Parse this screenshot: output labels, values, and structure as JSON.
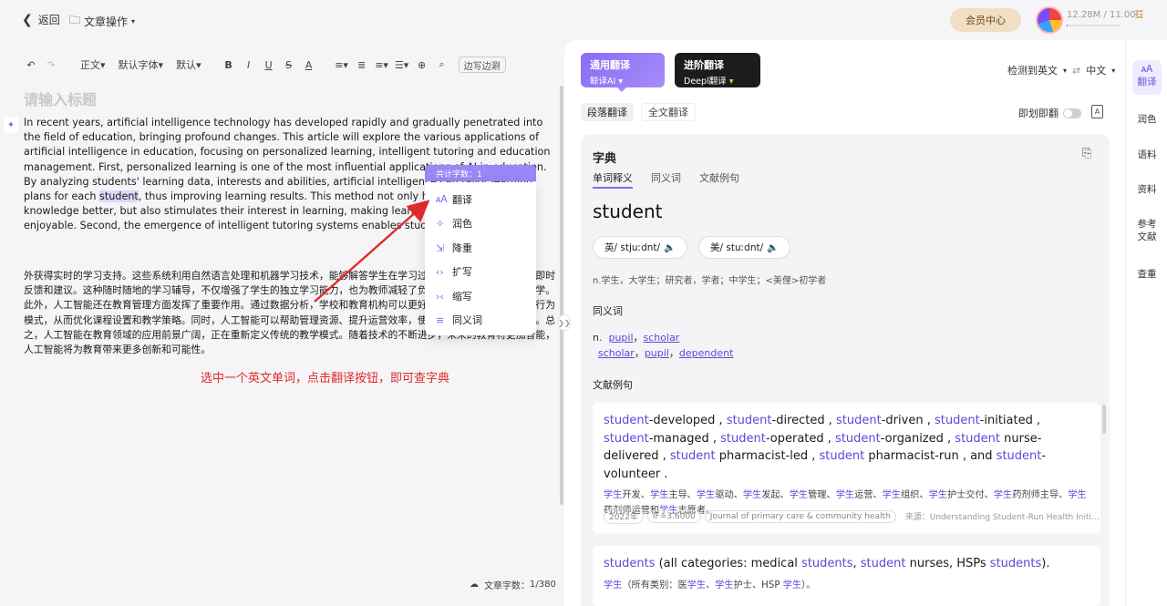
{
  "header": {
    "back_label": "返回",
    "doc_menu_label": "文章操作",
    "member_label": "会员中心",
    "storage_text": "12.28M / 11.00G",
    "storage_used_fraction": 0.01
  },
  "toolbar": {
    "style_label": "正文",
    "font_label": "默认字体",
    "size_label": "默认",
    "edit_border_label": "边写边涮"
  },
  "editor": {
    "title_placeholder": "请输入标题",
    "en_before": "In recent years, artificial intelligence technology has developed rapidly and gradually penetrated into the field of education, bringing profound changes. This article will explore the various applications of artificial intelligence in education, focusing on personalized learning, intelligent tutoring and education management. First, personalized learning is one of the most influential applications of AI in education. By analyzing students' learning data, interests and abilities, artificial intelligence can tailor learning plans for each ",
    "en_highlight": "student",
    "en_after": ", thus improving learning results. This method not only helps students master knowledge better, but also stimulates their interest in learning, making learning more efficient and enjoyable. Second, the emergence of intelligent tutoring systems enables students to learn in class.",
    "zh_para": "外获得实时的学习支持。这些系统利用自然语言处理和机器学习技术，能够解答学生在学习过程中遇到的问题，并提供即时反馈和建议。这种随时随地的学习辅导，不仅增强了学生的独立学习能力，也为教师减轻了负担，让他们有更多时间教学。此外，人工智能还在教育管理方面发挥了重要作用。通过数据分析，学校和教育机构可以更好地了解学生的学习情况和行为模式，从而优化课程设置和教学策略。同时，人工智能可以帮助管理资源、提升运营效率，使教育管理更加科学和精准。总之，人工智能在教育领域的应用前景广阔，正在重新定义传统的教学模式。随着技术的不断进步，未来的教育将更加智能，人工智能将为教育带来更多创新和可能性。",
    "hint": "选中一个英文单词，点击翻译按钮，即可查字典",
    "word_count_label": "文章字数：",
    "word_count_value": "1/380"
  },
  "context_menu": {
    "header": "共计字数：1",
    "items": [
      {
        "label": "翻译",
        "icon": "translate-icon"
      },
      {
        "label": "润色",
        "icon": "polish-icon"
      },
      {
        "label": "降重",
        "icon": "reduce-icon"
      },
      {
        "label": "扩写",
        "icon": "expand-icon"
      },
      {
        "label": "缩写",
        "icon": "shrink-icon"
      },
      {
        "label": "同义词",
        "icon": "synonym-icon"
      }
    ]
  },
  "panel": {
    "general": {
      "title": "通用翻译",
      "engine": "鲸译AI"
    },
    "advanced": {
      "title": "进阶翻译",
      "engine": "Deepl翻译"
    },
    "detect_label": "检测到英文",
    "target_lang": "中文",
    "mode_para": "段落翻译",
    "mode_full": "全文翻译",
    "instant_label": "即划即翻"
  },
  "dictionary": {
    "title": "字典",
    "tabs": [
      "单词释义",
      "同义词",
      "文献例句"
    ],
    "word": "student",
    "pron_uk": "英/ stjuːdnt/",
    "pron_us": "美/ stuːdnt/",
    "definition": "n.学生，大学生；研究者，学者；中学生；<美俚>初学者",
    "synonyms_title": "同义词",
    "syn_pos": "n.",
    "syn_line1": [
      "pupil",
      "scholar"
    ],
    "syn_line2": [
      "scholar",
      "pupil",
      "dependent"
    ],
    "examples_title": "文献例句",
    "ex1_en": "student-developed , student-directed , student-driven , student-initiated , student-managed , student-operated , student-organized , student nurse-delivered , student pharmacist-led , student pharmacist-run , and student-volunteer .",
    "ex1_zh": "学生开发、学生主导、学生驱动、学生发起、学生管理、学生运营、学生组织、学生护士交付、学生药剂师主导、学生药剂师运营和学生志愿者。",
    "ex1_year": "2022年",
    "ex1_if": "IF=3.6000",
    "ex1_journal": "Journal of primary care & community health",
    "ex1_source": "来源：Understanding Student-Run Health Initi...",
    "ex2_en": "students (all categories: medical students, student nurses, HSPs students).",
    "ex2_zh": "学生（所有类别：医学生、学生护士、HSP 学生）。"
  },
  "rail": {
    "items": [
      "翻译",
      "润色",
      "语料",
      "资料",
      "参考文献",
      "查重"
    ]
  }
}
